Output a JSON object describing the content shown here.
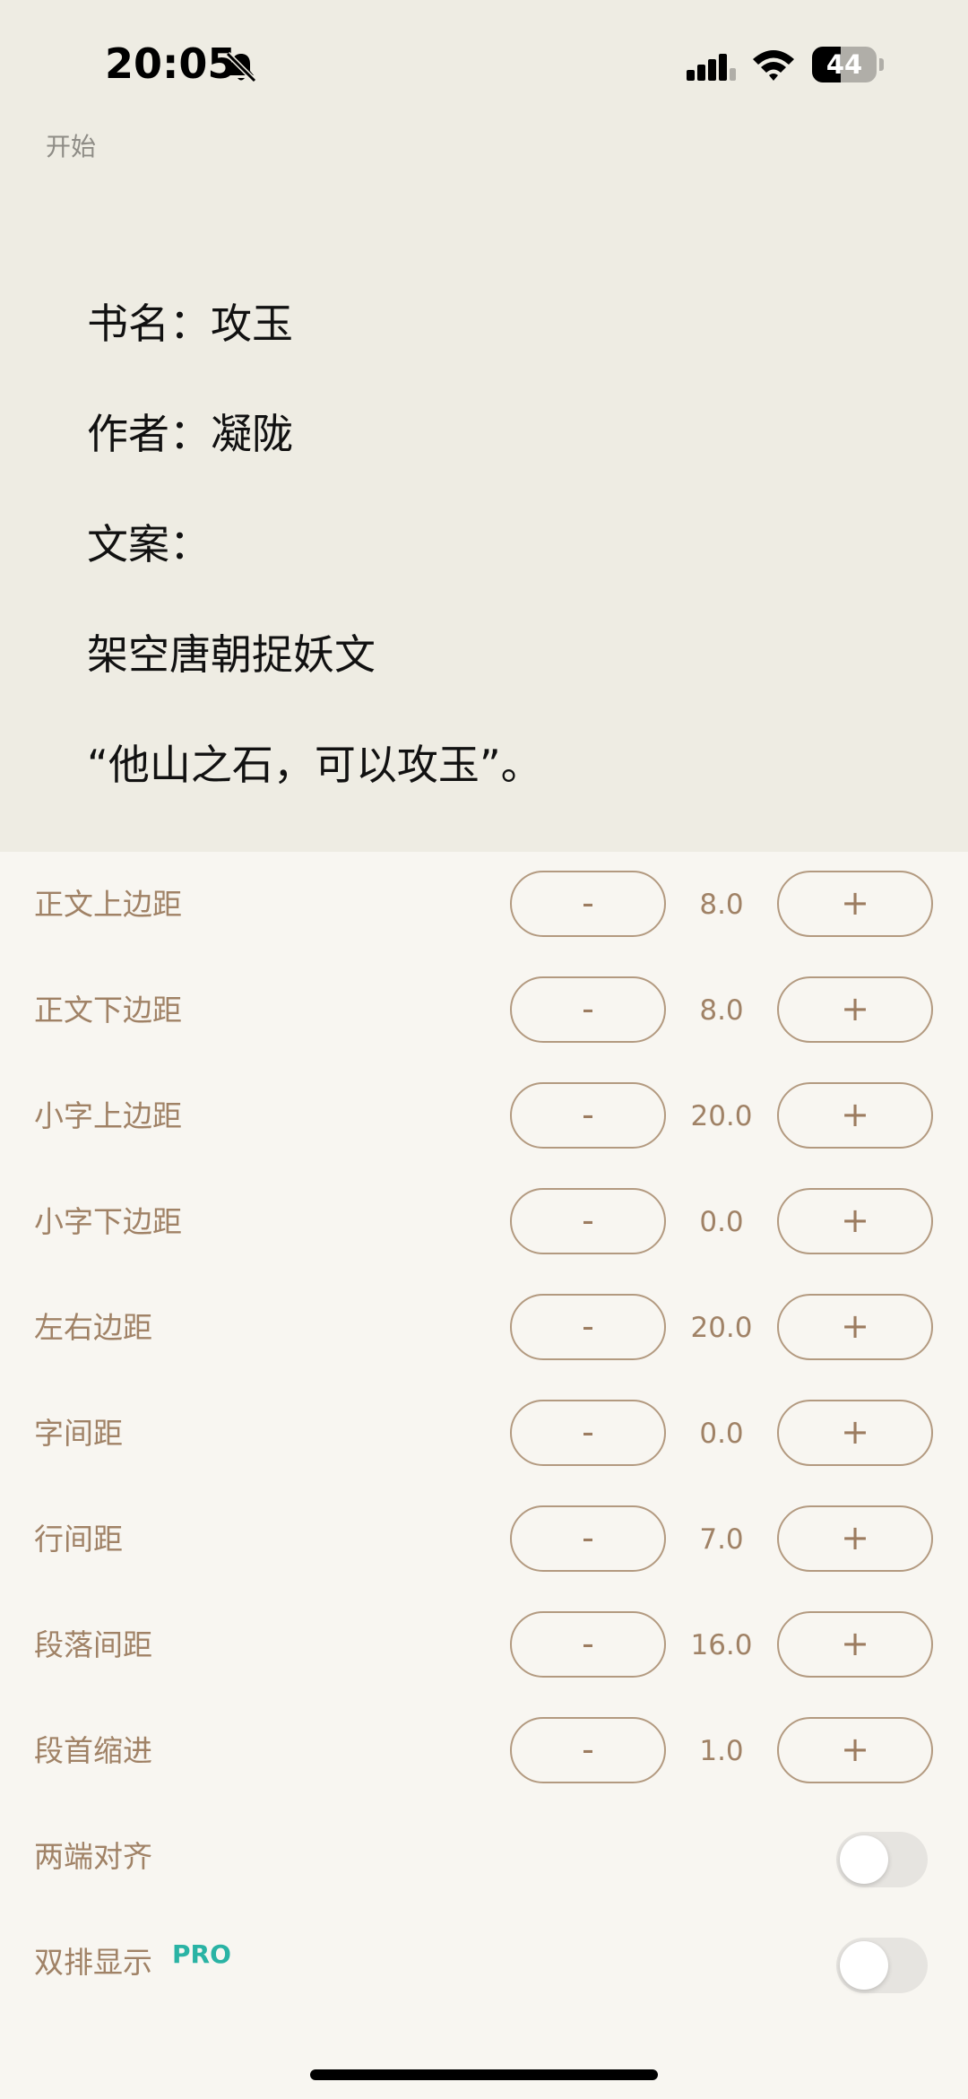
{
  "status_bar": {
    "time": "20:05",
    "battery_level": "44",
    "battery_fraction": 0.44
  },
  "reader": {
    "chapter_label": "开始",
    "lines": [
      "书名：攻玉",
      "作者：凝陇",
      "文案：",
      "架空唐朝捉妖文",
      "“他山之石，可以攻玉”。"
    ]
  },
  "settings": {
    "minus_label": "-",
    "plus_label": "+",
    "steppers": [
      {
        "label": "正文上边距",
        "value": "8.0"
      },
      {
        "label": "正文下边距",
        "value": "8.0"
      },
      {
        "label": "小字上边距",
        "value": "20.0"
      },
      {
        "label": "小字下边距",
        "value": "0.0"
      },
      {
        "label": "左右边距",
        "value": "20.0"
      },
      {
        "label": "字间距",
        "value": "0.0"
      },
      {
        "label": "行间距",
        "value": "7.0"
      },
      {
        "label": "段落间距",
        "value": "16.0"
      },
      {
        "label": "段首缩进",
        "value": "1.0"
      }
    ],
    "justify": {
      "label": "两端对齐",
      "enabled": false
    },
    "dual_column": {
      "label": "双排显示",
      "badge": "PRO",
      "enabled": false
    }
  },
  "colors": {
    "preview_background": "#eeece3",
    "panel_background": "#f8f6f1",
    "label_brown": "#a08266",
    "pro_teal": "#2ab3a4"
  },
  "icons": [
    "bell-off-icon",
    "signal-icon",
    "wifi-icon",
    "battery-icon"
  ]
}
